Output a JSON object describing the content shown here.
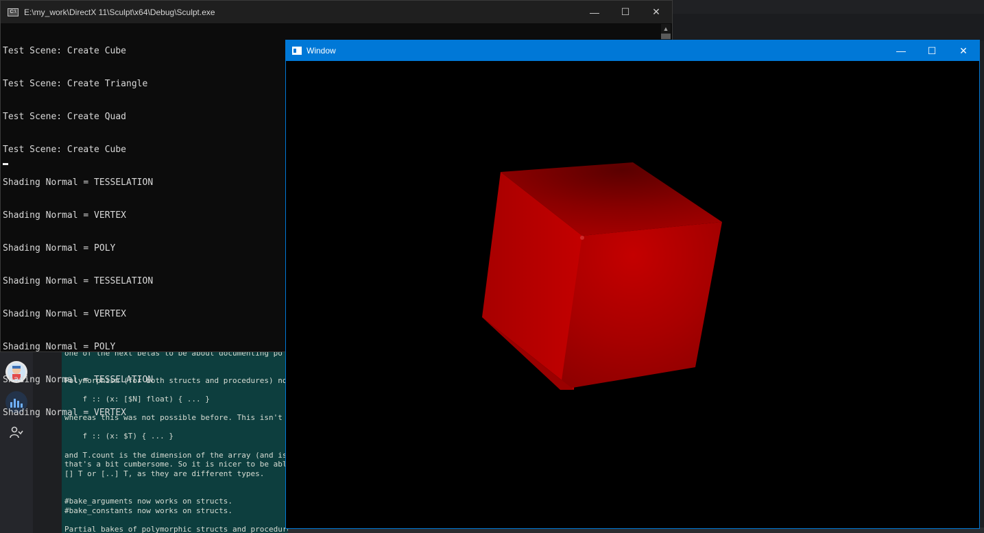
{
  "console": {
    "title": "E:\\my_work\\DirectX 11\\Sculpt\\x64\\Debug\\Sculpt.exe",
    "app_icon": "C:\\",
    "lines": [
      "Test Scene: Create Cube",
      "Test Scene: Create Triangle",
      "Test Scene: Create Quad",
      "Test Scene: Create Cube",
      "Shading Normal = TESSELATION",
      "Shading Normal = VERTEX",
      "Shading Normal = POLY",
      "Shading Normal = TESSELATION",
      "Shading Normal = VERTEX",
      "Shading Normal = POLY",
      "Shading Normal = TESSELATION",
      "Shading Normal = VERTEX"
    ],
    "controls": {
      "minimize": "—",
      "maximize": "☐",
      "close": "✕"
    }
  },
  "dx_window": {
    "title": "Window",
    "controls": {
      "minimize": "—",
      "maximize": "☐",
      "close": "✕"
    },
    "cube_color": "#b30000",
    "background_color": "#000000"
  },
  "background": {
    "text_lines": [
      "one of the next betas to be about documenting po",
      "",
      "Polymorphism (for both structs and procedures) no",
      "",
      "    f :: (x: [$N] float) { ... }",
      "",
      "whereas this was not possible before. This isn't",
      "",
      "    f :: (x: $T) { ... }",
      "",
      "and T.count is the dimension of the array (and is",
      "that's a bit cumbersome. So it is nicer to be abl",
      "[] T or [..] T, as they are different types.",
      "",
      "",
      "#bake_arguments now works on structs.",
      "#bake_constants now works on structs.",
      "",
      "Partial bakes of polymorphic structs and procedures"
    ]
  }
}
